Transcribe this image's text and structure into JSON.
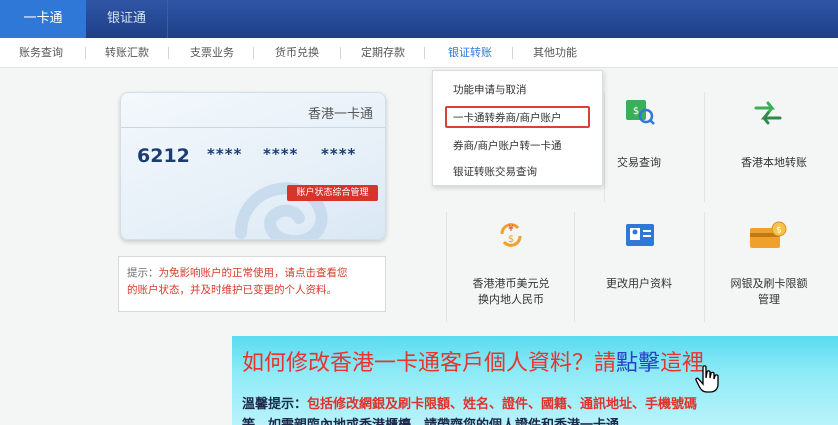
{
  "top_tabs": [
    {
      "label": "一卡通",
      "active": true
    },
    {
      "label": "银证通",
      "active": false
    }
  ],
  "sub_tabs": [
    {
      "label": "账务查询"
    },
    {
      "label": "转账汇款"
    },
    {
      "label": "支票业务"
    },
    {
      "label": "货币兑换"
    },
    {
      "label": "定期存款"
    },
    {
      "label": "银证转账",
      "active": true
    },
    {
      "label": "其他功能"
    }
  ],
  "card": {
    "title": "香港一卡通",
    "number_prefix": "6212",
    "masked": [
      "****",
      "****",
      "****"
    ],
    "status_button": "账户状态综合管理"
  },
  "notice": {
    "hint": "提示：",
    "message_part1": "为免影响账户的正常使用，请点击查看您",
    "message_part2": "的账户状态，并及时维护已变更的个人资料。"
  },
  "dropdown": {
    "items": [
      "功能申请与取消",
      "一卡通转券商/商户账户",
      "券商/商户账户转一卡通",
      "银证转账交易查询"
    ],
    "highlighted_index": 1
  },
  "tiles": [
    {
      "label": "交易查询",
      "icon": "search-document-icon"
    },
    {
      "label": "香港本地转账",
      "icon": "transfer-icon"
    },
    {
      "label_line1": "香港港币美元兑",
      "label_line2": "换内地人民币",
      "icon": "currency-exchange-icon"
    },
    {
      "label": "更改用户资料",
      "icon": "user-card-icon"
    },
    {
      "label_line1": "网银及刷卡限额",
      "label_line2": "管理",
      "icon": "card-limit-icon"
    }
  ],
  "banner": {
    "title_red": "如何修改香港一卡通客戶個人資料？請",
    "title_blue": "點擊",
    "title_tail": "這裡",
    "line1_lead": "溫馨提示：",
    "line1_red": "包括修改網銀及刷卡限額、姓名、證件、國籍、通訊地址、手機號碼",
    "line2_lead": "等，如需親臨內地或香港櫃檯，請帶齊您的個人證件和香港一卡通"
  },
  "colors": {
    "nav_dark": "#1f3f86",
    "nav_active": "#2f78d7",
    "accent_red": "#d9342b",
    "banner_cyan": "#59dbf0"
  }
}
